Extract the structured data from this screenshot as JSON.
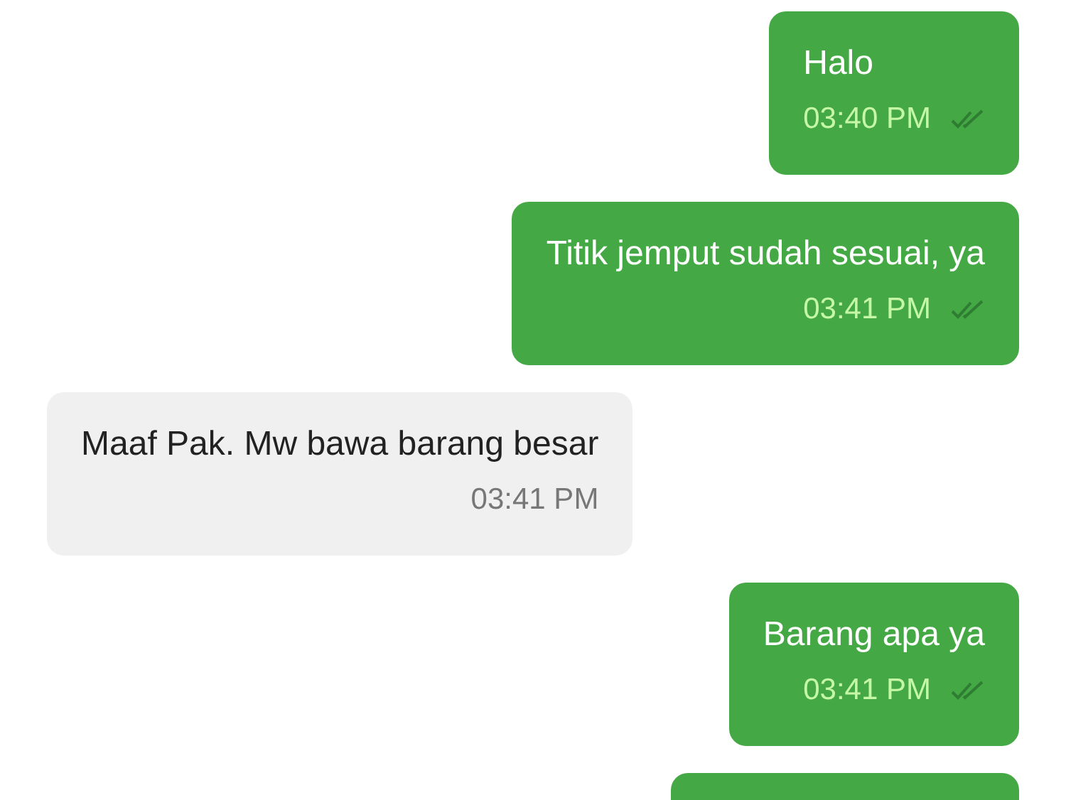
{
  "messages": [
    {
      "kind": "out",
      "text": "Halo",
      "time": "03:40 PM",
      "read": true
    },
    {
      "kind": "out",
      "text": "Titik jemput sudah sesuai, ya",
      "time": "03:41 PM",
      "read": true
    },
    {
      "kind": "in",
      "text": "Maaf Pak. Mw bawa barang besar",
      "time": "03:41 PM"
    },
    {
      "kind": "out",
      "text": "Barang apa ya",
      "time": "03:41 PM",
      "read": true
    },
    {
      "kind": "out"
    }
  ]
}
